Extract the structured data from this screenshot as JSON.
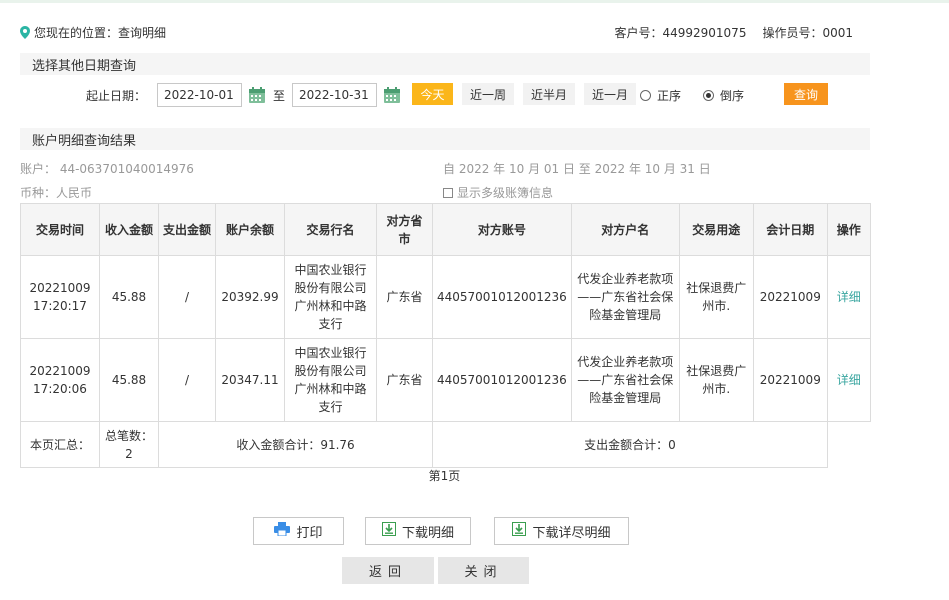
{
  "location": {
    "label": "您现在的位置：查询明细"
  },
  "customer": {
    "id_label": "客户号：44992901075",
    "operator_label": "操作员号：0001"
  },
  "filter": {
    "section_title": "选择其他日期查询",
    "date_label": "起止日期：",
    "start_date": "2022-10-01",
    "to_label": "至",
    "end_date": "2022-10-31",
    "quick": [
      "今天",
      "近一周",
      "近半月",
      "近一月"
    ],
    "order_asc": "正序",
    "order_desc": "倒序",
    "order_selected": "倒序",
    "query_label": "查询"
  },
  "results": {
    "section_title": "账户明细查询结果",
    "account": "账户： 44-063701040014976",
    "currency": "币种：人民币",
    "range": "自 2022 年 10 月 01 日 至 2022 年 10 月 31 日",
    "multi_ledger_label": "显示多级账簿信息",
    "multi_ledger_checked": false
  },
  "table": {
    "headers": [
      "交易时间",
      "收入金额",
      "支出金额",
      "账户余额",
      "交易行名",
      "对方省市",
      "对方账号",
      "对方户名",
      "交易用途",
      "会计日期",
      "操作"
    ],
    "rows": [
      [
        "20221009 17:20:17",
        "45.88",
        "/",
        "20392.99",
        "中国农业银行股份有限公司广州林和中路支行",
        "广东省",
        "44057001012001236",
        "代发企业养老款项——广东省社会保险基金管理局",
        "社保退费广州市.",
        "20221009",
        "详细"
      ],
      [
        "20221009 17:20:06",
        "45.88",
        "/",
        "20347.11",
        "中国农业银行股份有限公司广州林和中路支行",
        "广东省",
        "44057001012001236",
        "代发企业养老款项——广东省社会保险基金管理局",
        "社保退费广州市.",
        "20221009",
        "详细"
      ]
    ],
    "summary": {
      "label": "本页汇总：",
      "count": "总笔数：2",
      "income_total": "收入金额合计：91.76",
      "expense_total": "支出金额合计：0"
    }
  },
  "pagination": {
    "page": "第1页"
  },
  "actions": {
    "print": "打印",
    "download_detail": "下载明细",
    "download_full": "下载详尽明细",
    "back": "返回",
    "close": "关闭"
  },
  "colors": {
    "accent_yellow": "#fbb61a",
    "accent_orange": "#f7941d",
    "link_teal": "#3aa6a0",
    "location_pin": "#2bb5a4"
  },
  "icons": [
    "location-pin-icon",
    "calendar-icon",
    "printer-icon",
    "download-icon"
  ]
}
